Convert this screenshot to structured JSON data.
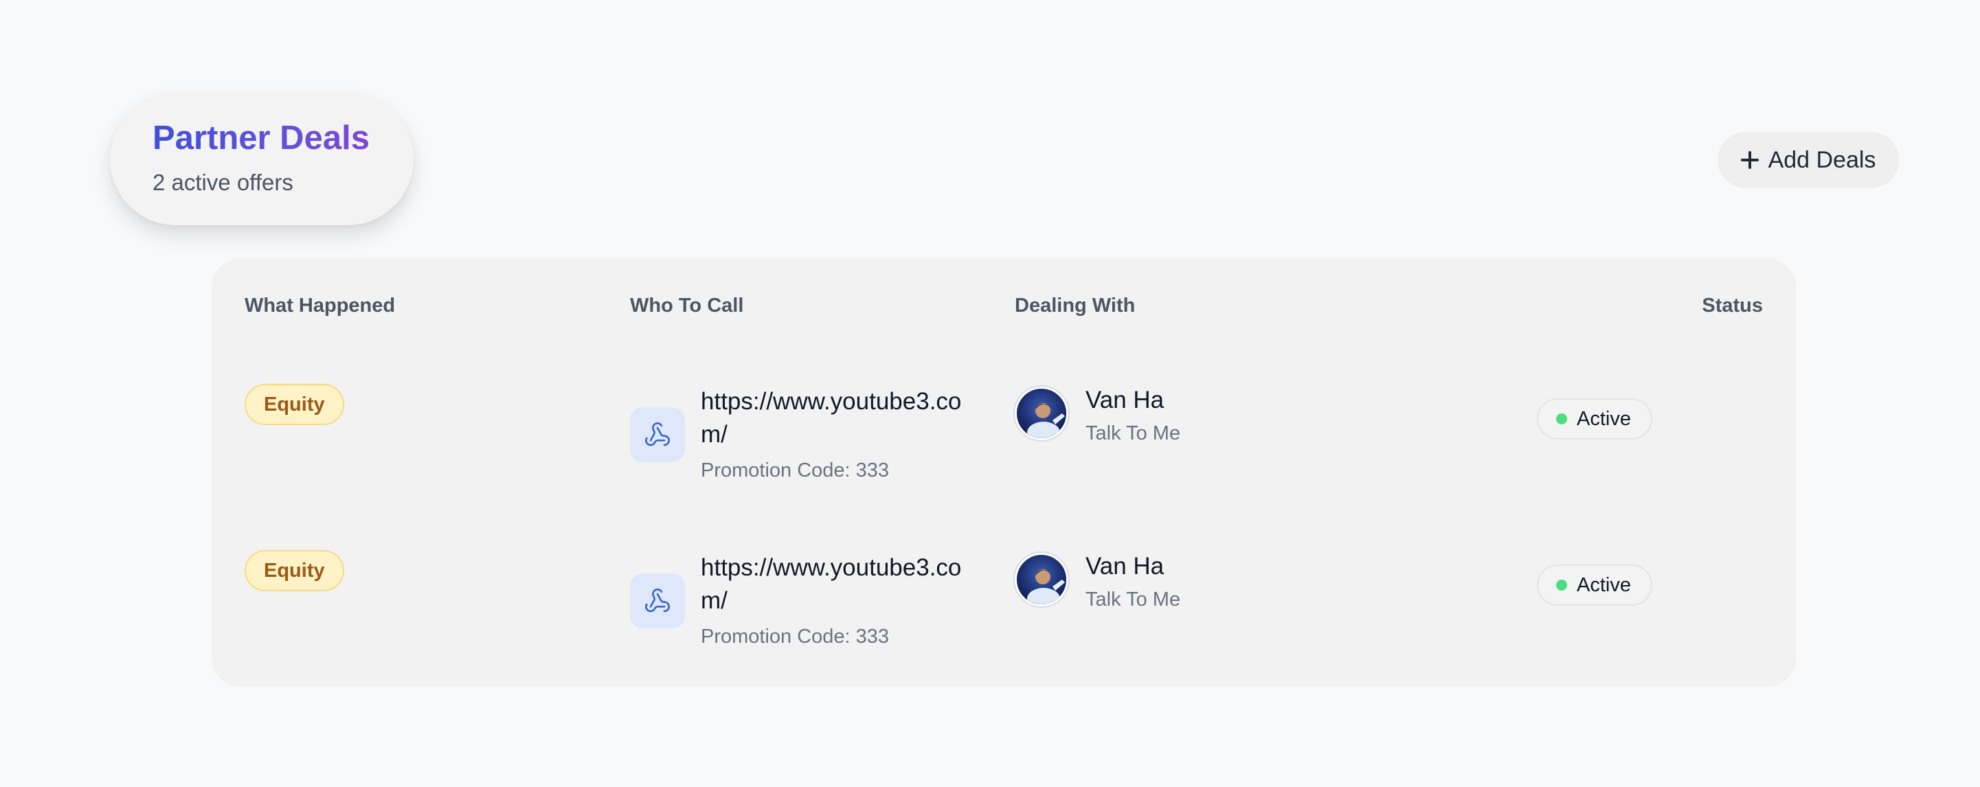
{
  "header": {
    "title": "Partner Deals",
    "subtitle": "2 active offers"
  },
  "toolbar": {
    "add_label": "Add Deals",
    "add_icon": "plus-icon"
  },
  "table": {
    "columns": [
      "What Happened",
      "Who To Call",
      "Dealing With",
      "Status"
    ],
    "rows": [
      {
        "type": "Equity",
        "link": "https://www.youtube3.com/",
        "link_icon": "webhook-icon",
        "promo": "Promotion Code: 333",
        "contact_name": "Van Ha",
        "contact_role": "Talk To Me",
        "status": "Active"
      },
      {
        "type": "Equity",
        "link": "https://www.youtube3.com/",
        "link_icon": "webhook-icon",
        "promo": "Promotion Code: 333",
        "contact_name": "Van Ha",
        "contact_role": "Talk To Me",
        "status": "Active"
      }
    ]
  },
  "colors": {
    "title_gradient_start": "#3f51d6",
    "title_gradient_end": "#8a3fd1",
    "equity_badge_bg": "#fdf3c7",
    "equity_badge_text": "#9a5a17",
    "link_icon_bg": "#dfe8fb",
    "link_icon_stroke": "#3b64c9",
    "status_active": "#4ade80"
  }
}
